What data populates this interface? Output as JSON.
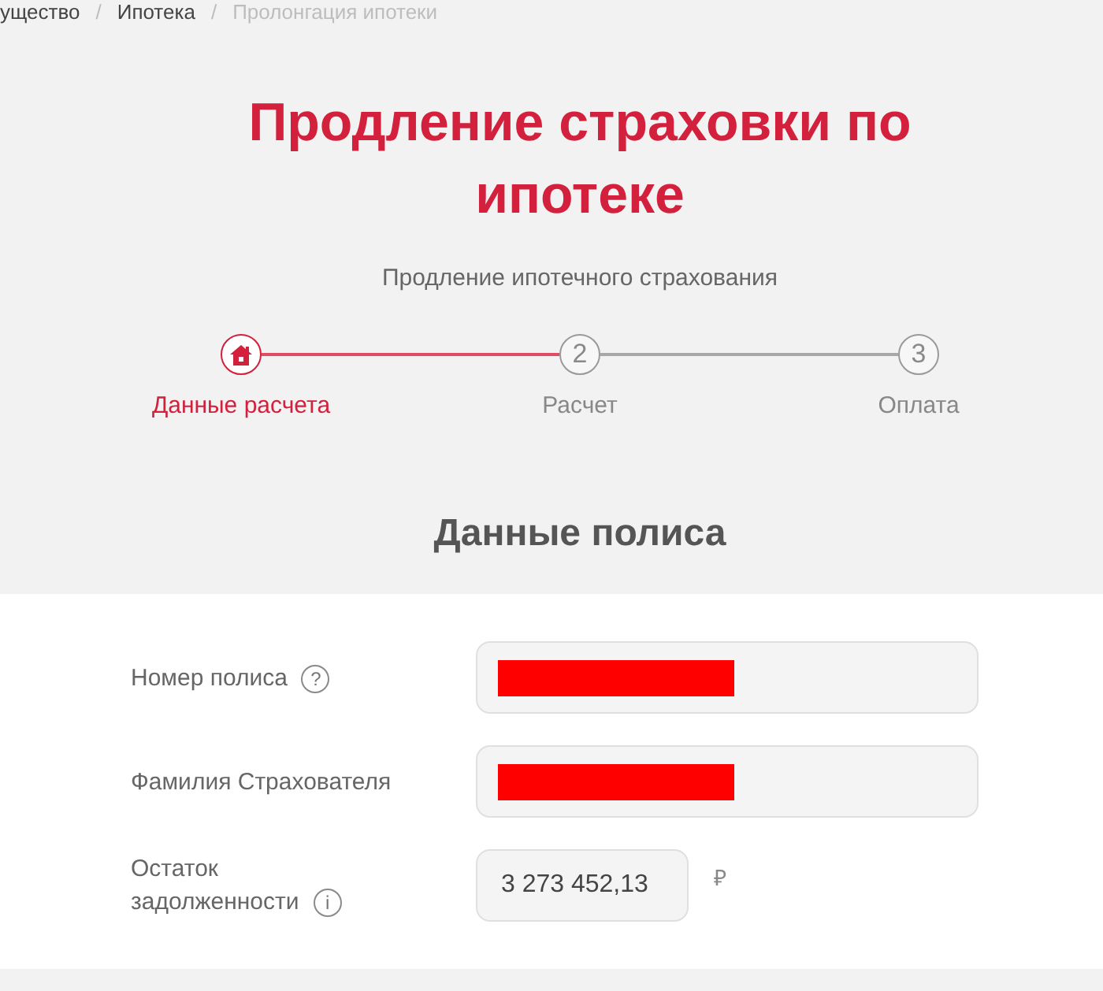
{
  "breadcrumb": {
    "separator": "/",
    "items": [
      {
        "label": "ущество",
        "current": false
      },
      {
        "label": "Ипотека",
        "current": false
      },
      {
        "label": "Пролонгация ипотеки",
        "current": true
      }
    ]
  },
  "title": "Продление страховки по ипотеке",
  "subtitle": "Продление ипотечного страхования",
  "steps": [
    {
      "kind": "icon",
      "label": "Данные расчета",
      "selected": true
    },
    {
      "kind": "number",
      "number": "2",
      "label": "Расчет",
      "selected": false
    },
    {
      "kind": "number",
      "number": "3",
      "label": "Оплата",
      "selected": false
    }
  ],
  "section_title": "Данные полиса",
  "form": {
    "fields": [
      {
        "kind": "text",
        "label": "Номер полиса",
        "hint": "?",
        "redacted": true
      },
      {
        "kind": "text",
        "label": "Фамилия Страхователя",
        "redacted": true
      },
      {
        "kind": "amount",
        "label": "Остаток задолженности",
        "hint": "i",
        "value": "3 273 452,13",
        "currency": "₽"
      }
    ]
  }
}
